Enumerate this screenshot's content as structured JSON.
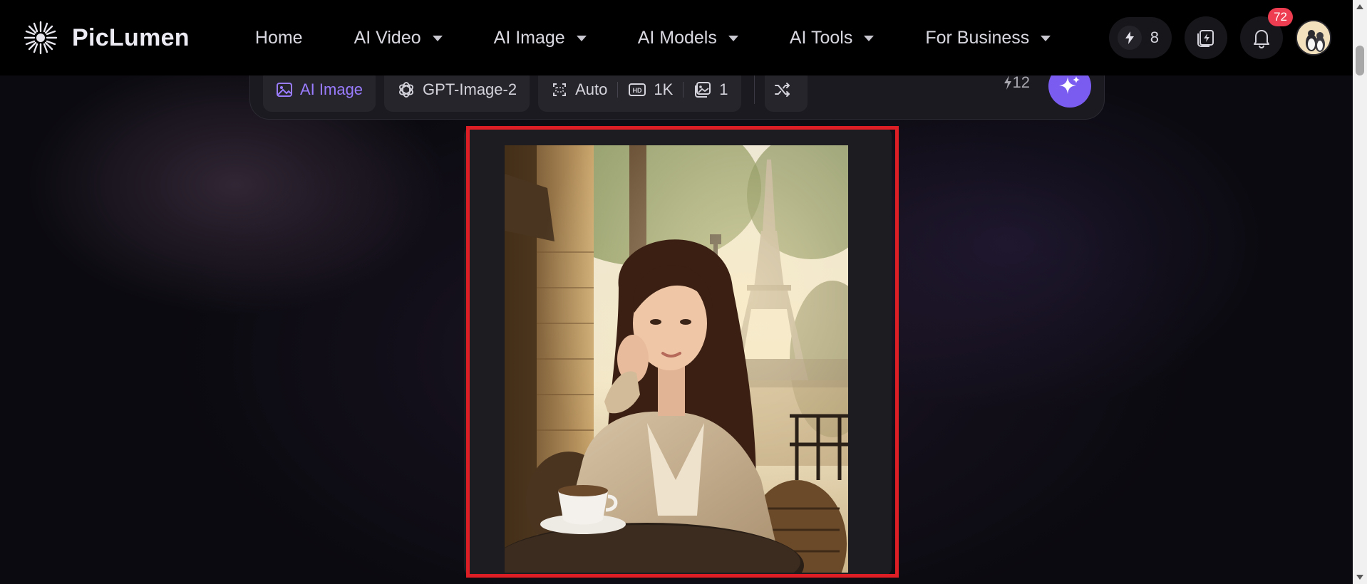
{
  "nav": {
    "brand": "PicLumen",
    "links": [
      {
        "label": "Home",
        "has_dropdown": false
      },
      {
        "label": "AI Video",
        "has_dropdown": true
      },
      {
        "label": "AI Image",
        "has_dropdown": true
      },
      {
        "label": "AI Models",
        "has_dropdown": true
      },
      {
        "label": "AI Tools",
        "has_dropdown": true
      },
      {
        "label": "For Business",
        "has_dropdown": true
      }
    ],
    "credits": "8",
    "notifications_count": "72"
  },
  "toolbar": {
    "mode_label": "AI Image",
    "model_label": "GPT-Image-2",
    "ratio_label": "Auto",
    "quality_label": "1K",
    "count_label": "1",
    "cost": "12"
  },
  "colors": {
    "accent": "#7b5cf0",
    "accent_text": "#9a7cff",
    "highlight": "#dd1e24",
    "badge": "#ee3d50"
  },
  "icons": [
    "piclumen-logo-icon",
    "caret-down-icon",
    "bolt-icon",
    "card-bolt-icon",
    "bell-icon",
    "image-icon",
    "openai-icon",
    "aspect-ratio-icon",
    "hd-icon",
    "images-icon",
    "shuffle-icon",
    "sparkle-icon"
  ]
}
